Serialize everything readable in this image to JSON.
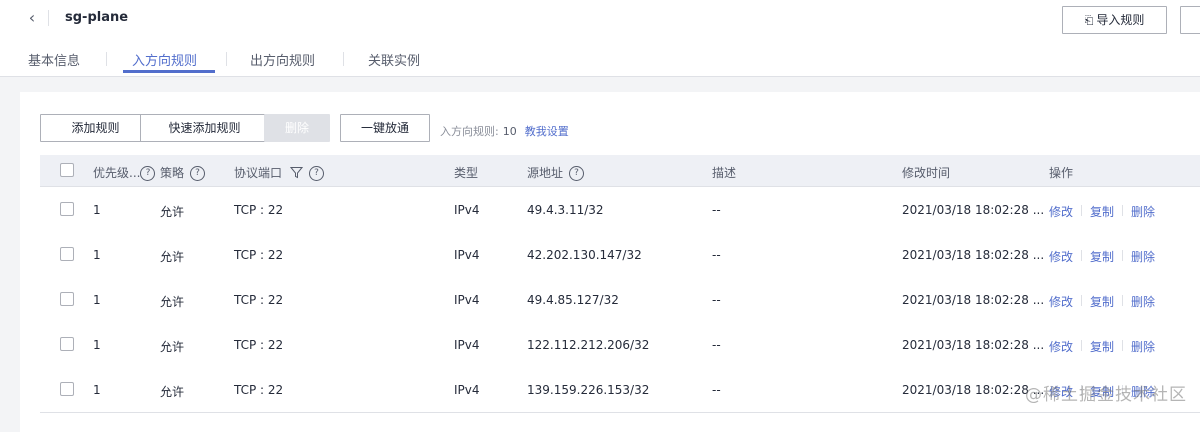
{
  "header": {
    "title": "sg-plane",
    "back_icon": "chevron-left-icon",
    "import_label": "导入规则"
  },
  "tabs": [
    {
      "label": "基本信息",
      "active": false
    },
    {
      "label": "入方向规则",
      "active": true
    },
    {
      "label": "出方向规则",
      "active": false
    },
    {
      "label": "关联实例",
      "active": false
    }
  ],
  "toolbar": {
    "add_label": "添加规则",
    "quick_add_label": "快速添加规则",
    "delete_label": "删除",
    "open_all_label": "一键放通",
    "rule_count_label": "入方向规则:",
    "rule_count": "10",
    "teach_link": "教我设置"
  },
  "table": {
    "headers": {
      "priority": "优先级...",
      "strategy": "策略",
      "protocol_port": "协议端口",
      "type": "类型",
      "source": "源地址",
      "description": "描述",
      "modified": "修改时间",
      "actions": "操作"
    },
    "rows": [
      {
        "priority": "1",
        "strategy": "允许",
        "protocol_port": "TCP : 22",
        "type": "IPv4",
        "source": "49.4.3.11/32",
        "description": "--",
        "modified": "2021/03/18 18:02:28 ..."
      },
      {
        "priority": "1",
        "strategy": "允许",
        "protocol_port": "TCP : 22",
        "type": "IPv4",
        "source": "42.202.130.147/32",
        "description": "--",
        "modified": "2021/03/18 18:02:28 ..."
      },
      {
        "priority": "1",
        "strategy": "允许",
        "protocol_port": "TCP : 22",
        "type": "IPv4",
        "source": "49.4.85.127/32",
        "description": "--",
        "modified": "2021/03/18 18:02:28 ..."
      },
      {
        "priority": "1",
        "strategy": "允许",
        "protocol_port": "TCP : 22",
        "type": "IPv4",
        "source": "122.112.212.206/32",
        "description": "--",
        "modified": "2021/03/18 18:02:28 ..."
      },
      {
        "priority": "1",
        "strategy": "允许",
        "protocol_port": "TCP : 22",
        "type": "IPv4",
        "source": "139.159.226.153/32",
        "description": "--",
        "modified": "2021/03/18 18:02:28 ..."
      }
    ],
    "actions": {
      "modify": "修改",
      "copy": "复制",
      "delete": "删除"
    }
  },
  "watermark": "@稀土掘金技术社区",
  "colors": {
    "accent": "#526ecc",
    "header_bg": "#eef0f5",
    "page_bg": "#f3f4f6"
  }
}
